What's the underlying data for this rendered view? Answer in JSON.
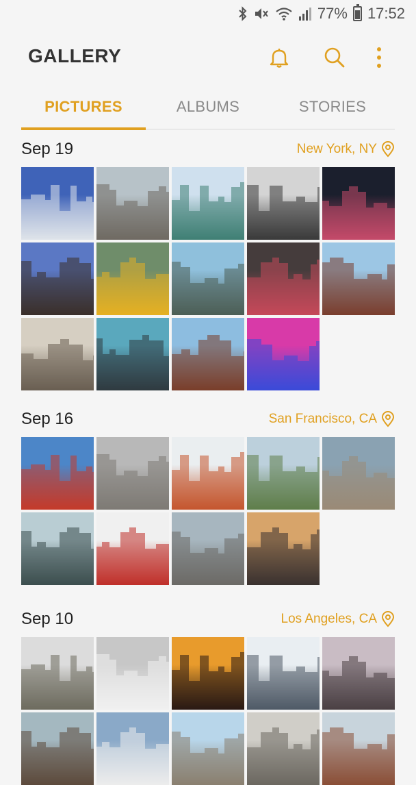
{
  "status": {
    "battery": "77%",
    "time": "17:52",
    "icons": [
      "bluetooth-icon",
      "mute-icon",
      "wifi-icon",
      "signal-icon",
      "battery-icon"
    ]
  },
  "header": {
    "title": "GALLERY",
    "icons": [
      "bell-icon",
      "search-icon",
      "more-vert-icon"
    ]
  },
  "tabs": [
    {
      "label": "PICTURES",
      "active": true
    },
    {
      "label": "ALBUMS",
      "active": false
    },
    {
      "label": "STORIES",
      "active": false
    }
  ],
  "accent": "#e0a020",
  "sections": [
    {
      "date": "Sep 19",
      "location": "New York, NY",
      "photos": [
        {
          "subject": "empire-state-building",
          "colors": [
            "#3f63b8",
            "#dfe3ea"
          ]
        },
        {
          "subject": "manhattan-skyline-aerial",
          "colors": [
            "#b7c2c8",
            "#6f6a62"
          ]
        },
        {
          "subject": "statue-of-liberty",
          "colors": [
            "#cfe0ee",
            "#3f7f74"
          ]
        },
        {
          "subject": "chrysler-building",
          "colors": [
            "#d4d4d4",
            "#3a3a3a"
          ]
        },
        {
          "subject": "times-square-night",
          "colors": [
            "#1b1f2d",
            "#c44a6a"
          ]
        },
        {
          "subject": "flatiron-building",
          "colors": [
            "#5b78c4",
            "#3b2f2a"
          ]
        },
        {
          "subject": "yellow-taxi",
          "colors": [
            "#6f8d6a",
            "#e6b022"
          ]
        },
        {
          "subject": "skyline-river-view",
          "colors": [
            "#8fc0dc",
            "#4c5e55"
          ]
        },
        {
          "subject": "busy-street",
          "colors": [
            "#453c3c",
            "#c5495a"
          ]
        },
        {
          "subject": "fire-escape-building",
          "colors": [
            "#9cc6e4",
            "#7a3e2e"
          ]
        },
        {
          "subject": "empire-state-misty",
          "colors": [
            "#d6cfc2",
            "#6a5f52"
          ]
        },
        {
          "subject": "harbor-skyline",
          "colors": [
            "#5aa8bd",
            "#2f3a40"
          ]
        },
        {
          "subject": "manhattan-bridge",
          "colors": [
            "#8dbde0",
            "#7a3e2a"
          ]
        },
        {
          "subject": "new-york-graffiti",
          "colors": [
            "#d83aa8",
            "#3b4bd8"
          ]
        }
      ]
    },
    {
      "date": "Sep 16",
      "location": "San Francisco, CA",
      "photos": [
        {
          "subject": "golden-gate-bridge",
          "colors": [
            "#4c86c8",
            "#c43a2a"
          ]
        },
        {
          "subject": "downtown-buildings",
          "colors": [
            "#b8b8b8",
            "#7e7a74"
          ]
        },
        {
          "subject": "bridge-underside",
          "colors": [
            "#eaeef0",
            "#c4562e"
          ]
        },
        {
          "subject": "coit-tower-alcatraz",
          "colors": [
            "#bcd0dc",
            "#5f7e4a"
          ]
        },
        {
          "subject": "transamerica-pyramid",
          "colors": [
            "#8aa2b2",
            "#9a8a76"
          ]
        },
        {
          "subject": "bay-coastline",
          "colors": [
            "#b9cdd3",
            "#3c4e4e"
          ]
        },
        {
          "subject": "red-bridge-tower",
          "colors": [
            "#f0f0f0",
            "#c0302a"
          ]
        },
        {
          "subject": "city-hills-aerial",
          "colors": [
            "#a7b6bf",
            "#6c6a66"
          ]
        },
        {
          "subject": "sunset-skyline",
          "colors": [
            "#d7a46a",
            "#3a3230"
          ]
        }
      ]
    },
    {
      "date": "Sep 10",
      "location": "Los Angeles, CA",
      "photos": [
        {
          "subject": "hollywood-sign-hills",
          "colors": [
            "#dcdcdc",
            "#6d6b5e"
          ]
        },
        {
          "subject": "the-broad-museum",
          "colors": [
            "#c7c7c7",
            "#f0f0f0"
          ]
        },
        {
          "subject": "la-sunset-silhouette",
          "colors": [
            "#e89b2c",
            "#2a1a14"
          ]
        },
        {
          "subject": "santa-monica-pier",
          "colors": [
            "#e9eef2",
            "#4f5a66"
          ]
        },
        {
          "subject": "downtown-la-dusk",
          "colors": [
            "#c9bcc4",
            "#4a4044"
          ]
        },
        {
          "subject": "venice-street",
          "colors": [
            "#a4b8c0",
            "#5c4a3c"
          ]
        },
        {
          "subject": "hollywood-sign-closeup",
          "colors": [
            "#8aa9c8",
            "#ececec"
          ]
        },
        {
          "subject": "venice-beach",
          "colors": [
            "#b8d6ea",
            "#8a8070"
          ]
        },
        {
          "subject": "storefronts",
          "colors": [
            "#d0cec8",
            "#6c6860"
          ]
        },
        {
          "subject": "brick-building",
          "colors": [
            "#c8d4dc",
            "#8a4e36"
          ]
        }
      ]
    }
  ]
}
